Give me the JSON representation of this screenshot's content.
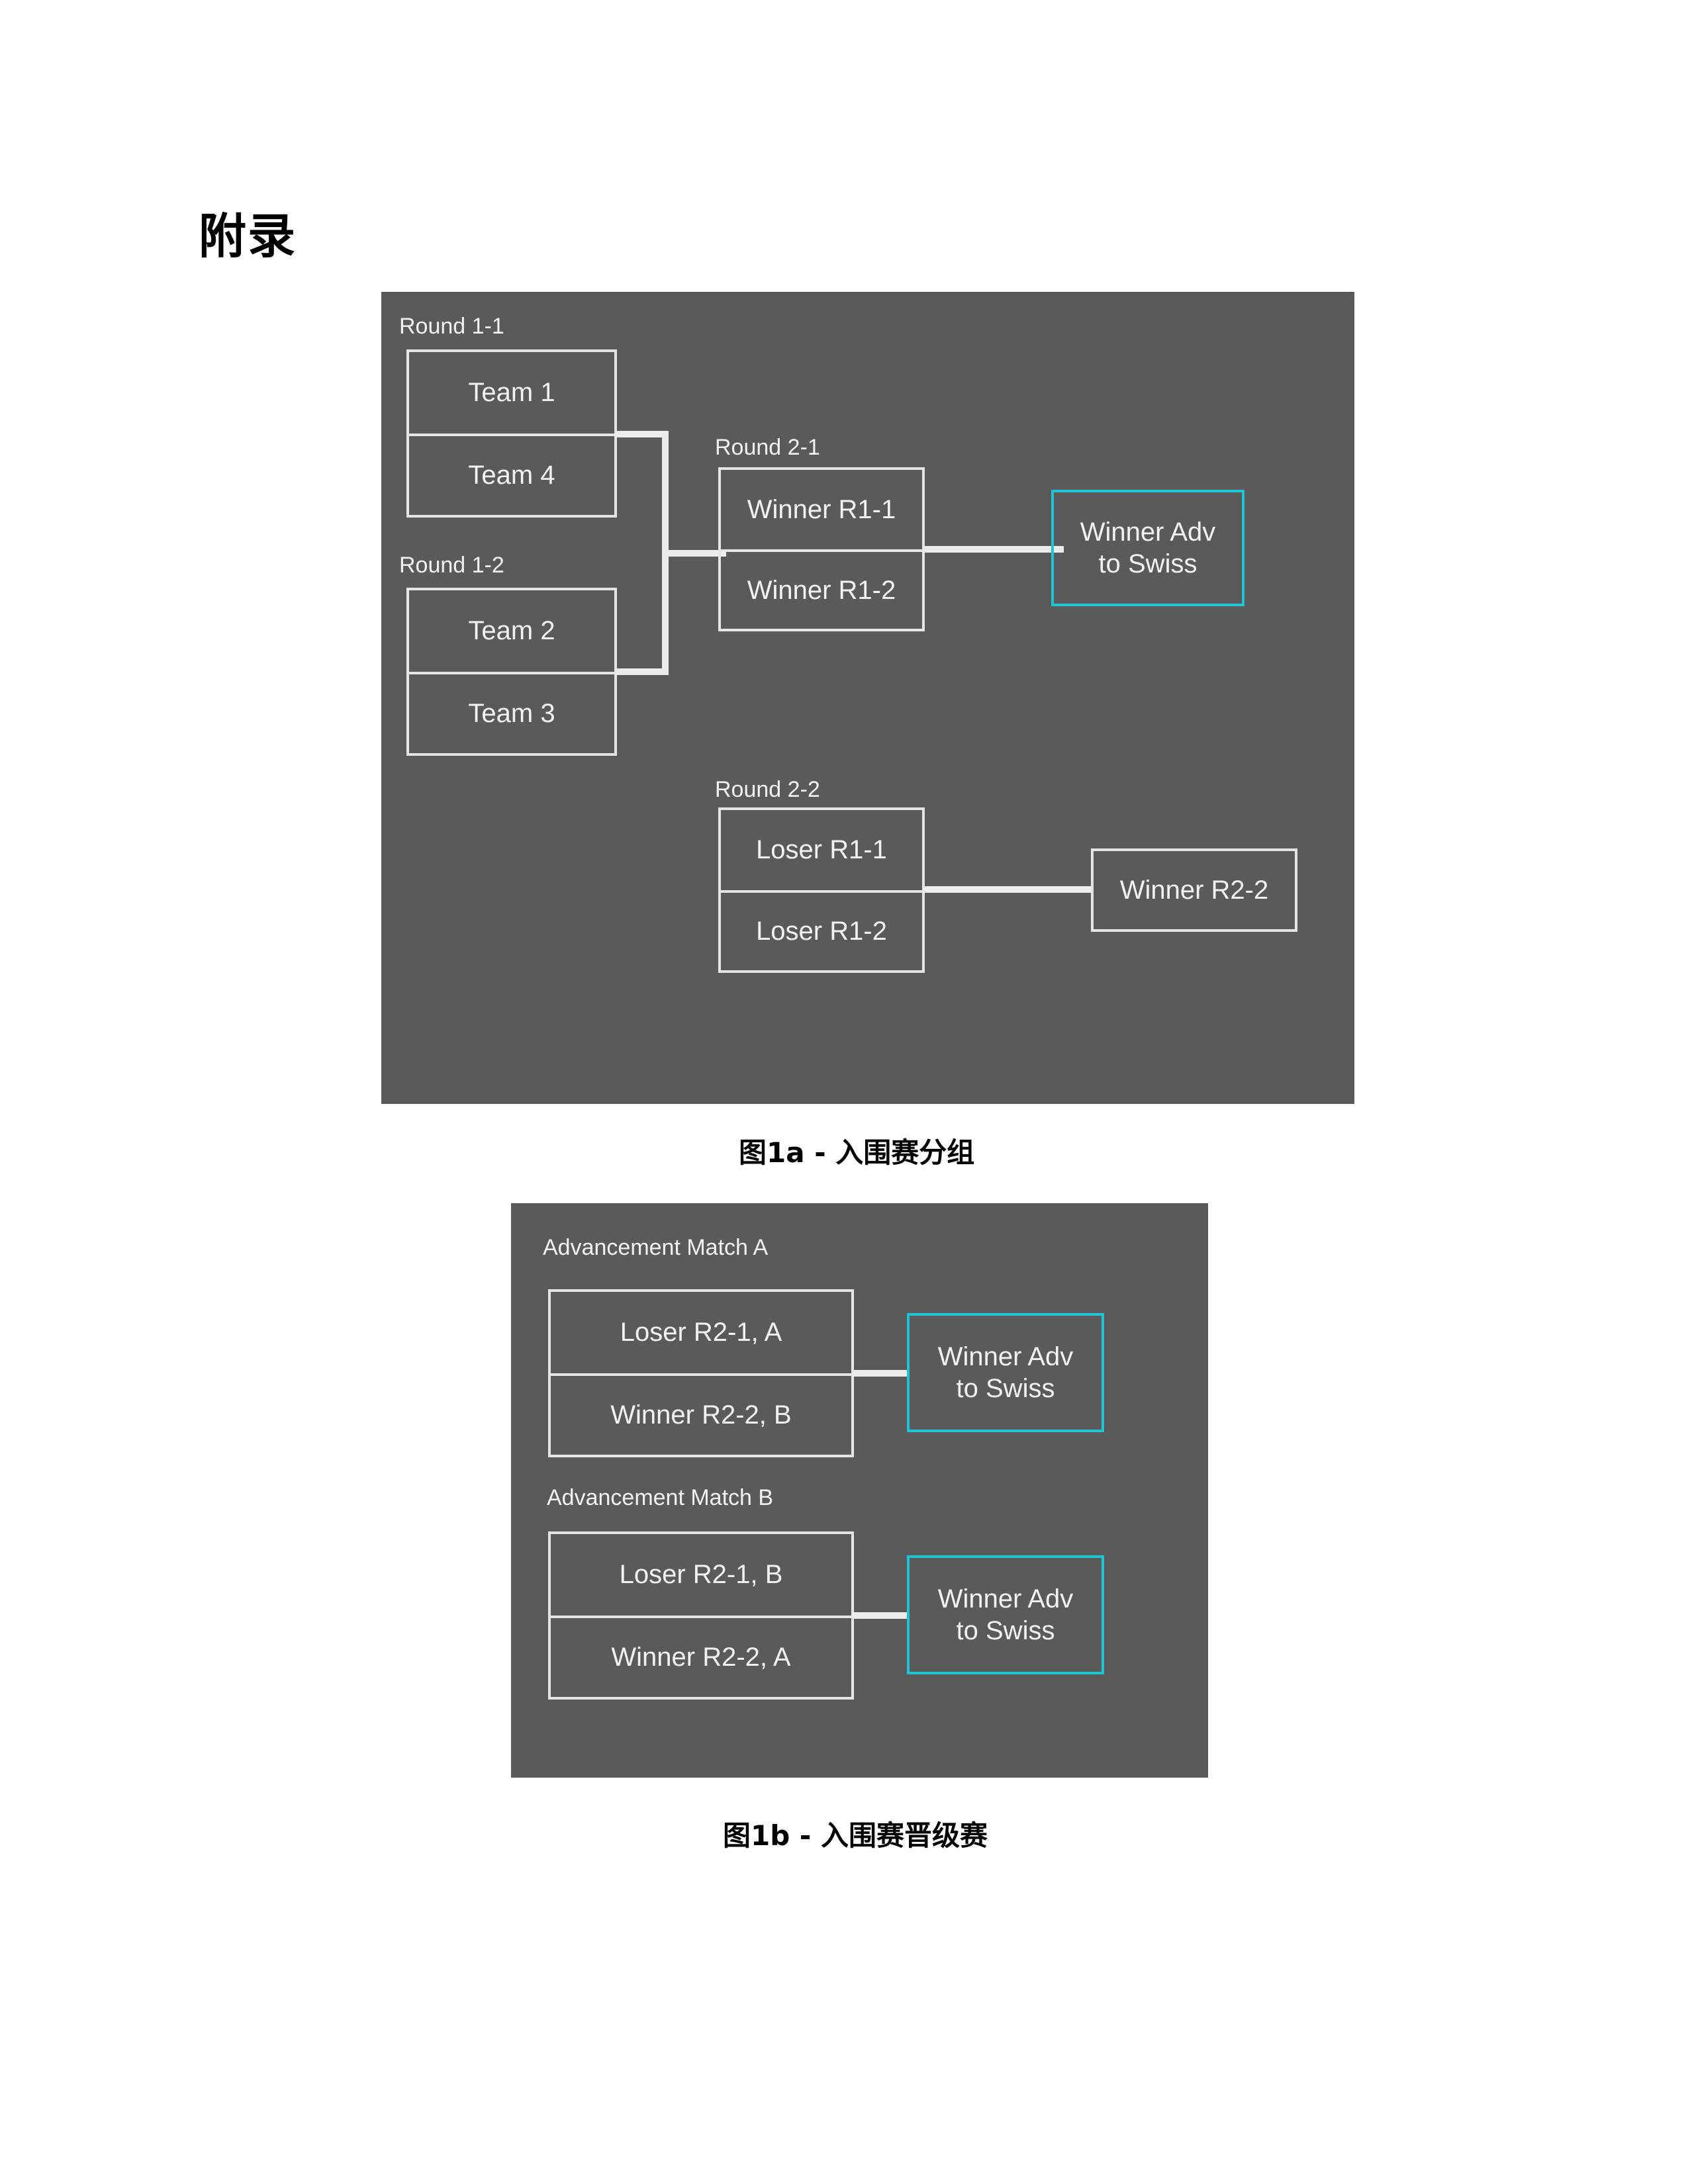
{
  "heading": "附录",
  "figure_1a": {
    "caption": "图1a - 入围赛分组",
    "round_1_1": {
      "label": "Round 1-1",
      "slots": [
        "Team 1",
        "Team 4"
      ]
    },
    "round_1_2": {
      "label": "Round 1-2",
      "slots": [
        "Team 2",
        "Team 3"
      ]
    },
    "round_2_1": {
      "label": "Round 2-1",
      "slots": [
        "Winner R1-1",
        "Winner R1-2"
      ],
      "result": [
        "Winner Adv",
        "to Swiss"
      ]
    },
    "round_2_2": {
      "label": "Round 2-2",
      "slots": [
        "Loser R1-1",
        "Loser R1-2"
      ],
      "result": "Winner R2-2"
    }
  },
  "figure_1b": {
    "caption": "图1b - 入围赛晋级赛",
    "match_a": {
      "label": "Advancement Match A",
      "slots": [
        "Loser R2-1, A",
        "Winner R2-2, B"
      ],
      "result": [
        "Winner Adv",
        "to Swiss"
      ]
    },
    "match_b": {
      "label": "Advancement Match B",
      "slots": [
        "Loser R2-1, B",
        "Winner R2-2, A"
      ],
      "result": [
        "Winner Adv",
        "to Swiss"
      ]
    }
  },
  "colors": {
    "panel": "#5a5a5a",
    "line": "#e6e6e6",
    "advance": "#1ec5d6"
  }
}
